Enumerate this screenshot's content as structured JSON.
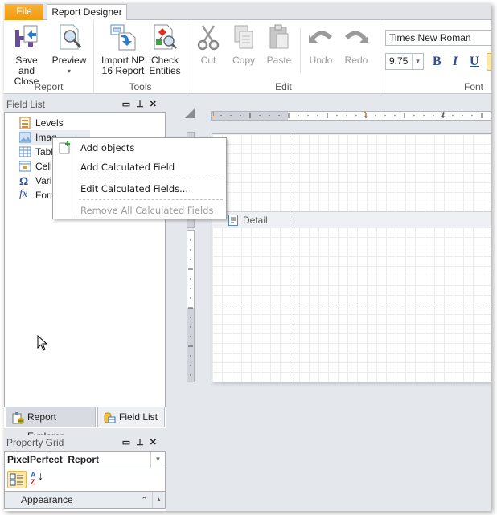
{
  "ribbon": {
    "tabs": [
      {
        "label": "File"
      },
      {
        "label": "Report Designer"
      }
    ],
    "groups": {
      "report": {
        "label": "Report",
        "buttons": [
          {
            "label1": "Save and",
            "label2": "Close",
            "icon": "save-icon"
          },
          {
            "label1": "Preview",
            "label2": "▾",
            "icon": "preview-icon"
          }
        ]
      },
      "tools": {
        "label": "Tools",
        "buttons": [
          {
            "label1": "Import NP",
            "label2": "16 Report",
            "icon": "import-icon"
          },
          {
            "label1": "Check",
            "label2": "Entities",
            "icon": "check-entities-icon"
          }
        ]
      },
      "edit": {
        "label": "Edit",
        "buttons": [
          {
            "label": "Cut",
            "icon": "scissors-icon"
          },
          {
            "label": "Copy",
            "icon": "copy-icon"
          },
          {
            "label": "Paste",
            "icon": "paste-icon"
          },
          {
            "label": "Undo",
            "icon": "undo-icon"
          },
          {
            "label": "Redo",
            "icon": "redo-icon"
          }
        ]
      },
      "font": {
        "label": "Font",
        "font_name": "Times New Roman",
        "font_size": "9.75",
        "bold": "B",
        "italic": "I",
        "underline": "U"
      }
    }
  },
  "field_list": {
    "title": "Field List",
    "items": [
      {
        "label": "Levels",
        "icon": "levels-icon"
      },
      {
        "label": "Images",
        "icon": "image-icon"
      },
      {
        "label": "Tables",
        "icon": "table-icon"
      },
      {
        "label": "Cells",
        "icon": "cells-icon"
      },
      {
        "label": "Variables",
        "icon": "omega-icon"
      },
      {
        "label": "Formulas",
        "icon": "fx-icon"
      }
    ],
    "visible_labels": [
      "Levels",
      "Imag",
      "Tabl",
      "Cells",
      "Varia",
      "Form"
    ]
  },
  "context_menu": {
    "items": [
      {
        "label": "Add objects",
        "enabled": true
      },
      {
        "label": "Add Calculated Field",
        "enabled": true
      },
      {
        "label": "Edit Calculated Fields...",
        "enabled": true
      },
      {
        "label": "Remove All Calculated Fields",
        "enabled": false
      }
    ]
  },
  "bottom_tabs": [
    {
      "label": "Report Explorer",
      "active": true
    },
    {
      "label": "Field List",
      "active": false
    }
  ],
  "property_grid": {
    "title": "Property Grid",
    "object_name": "PixelPerfect",
    "object_type": "Report",
    "category": "Appearance"
  },
  "designer": {
    "band_label": "Detail",
    "ruler_labels": [
      "1",
      "1",
      "2"
    ]
  }
}
